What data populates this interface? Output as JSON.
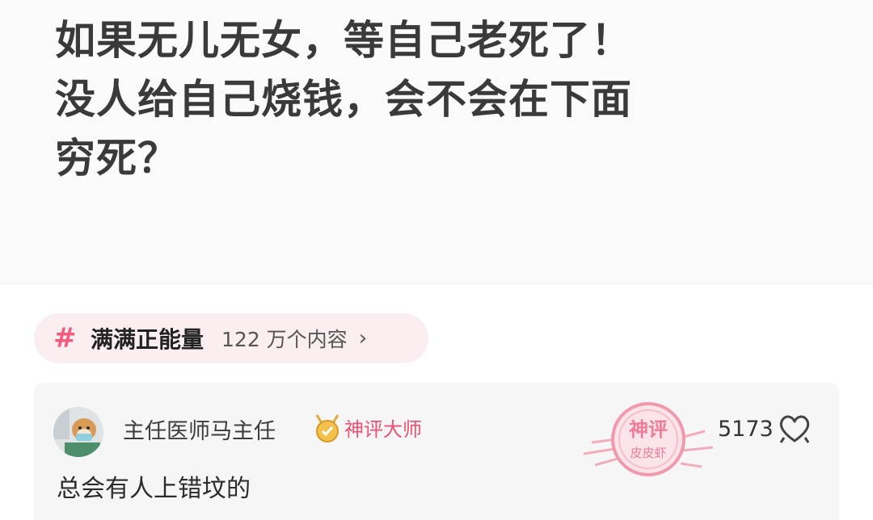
{
  "post": {
    "lines": [
      "如果无儿无女，等自己老死了！",
      "没人给自己烧钱，会不会在下面",
      "穷死？"
    ]
  },
  "topic": {
    "hash": "#",
    "name": "满满正能量",
    "count": "122 万个内容",
    "chevron": "›"
  },
  "comment": {
    "author": "主任医师马主任",
    "badge": "神评大师",
    "text": "总会有人上错坟的",
    "likes": "5173",
    "stamp_top": "神评",
    "stamp_bottom": "皮皮虾"
  },
  "colors": {
    "accent": "#ee4f72",
    "chip_bg": "#fbeef0",
    "card_bg": "#f6f6f6"
  },
  "icons": {
    "topic": "hash-icon",
    "badge": "medal-icon",
    "like": "heart-icon",
    "stamp": "stamp-icon"
  }
}
